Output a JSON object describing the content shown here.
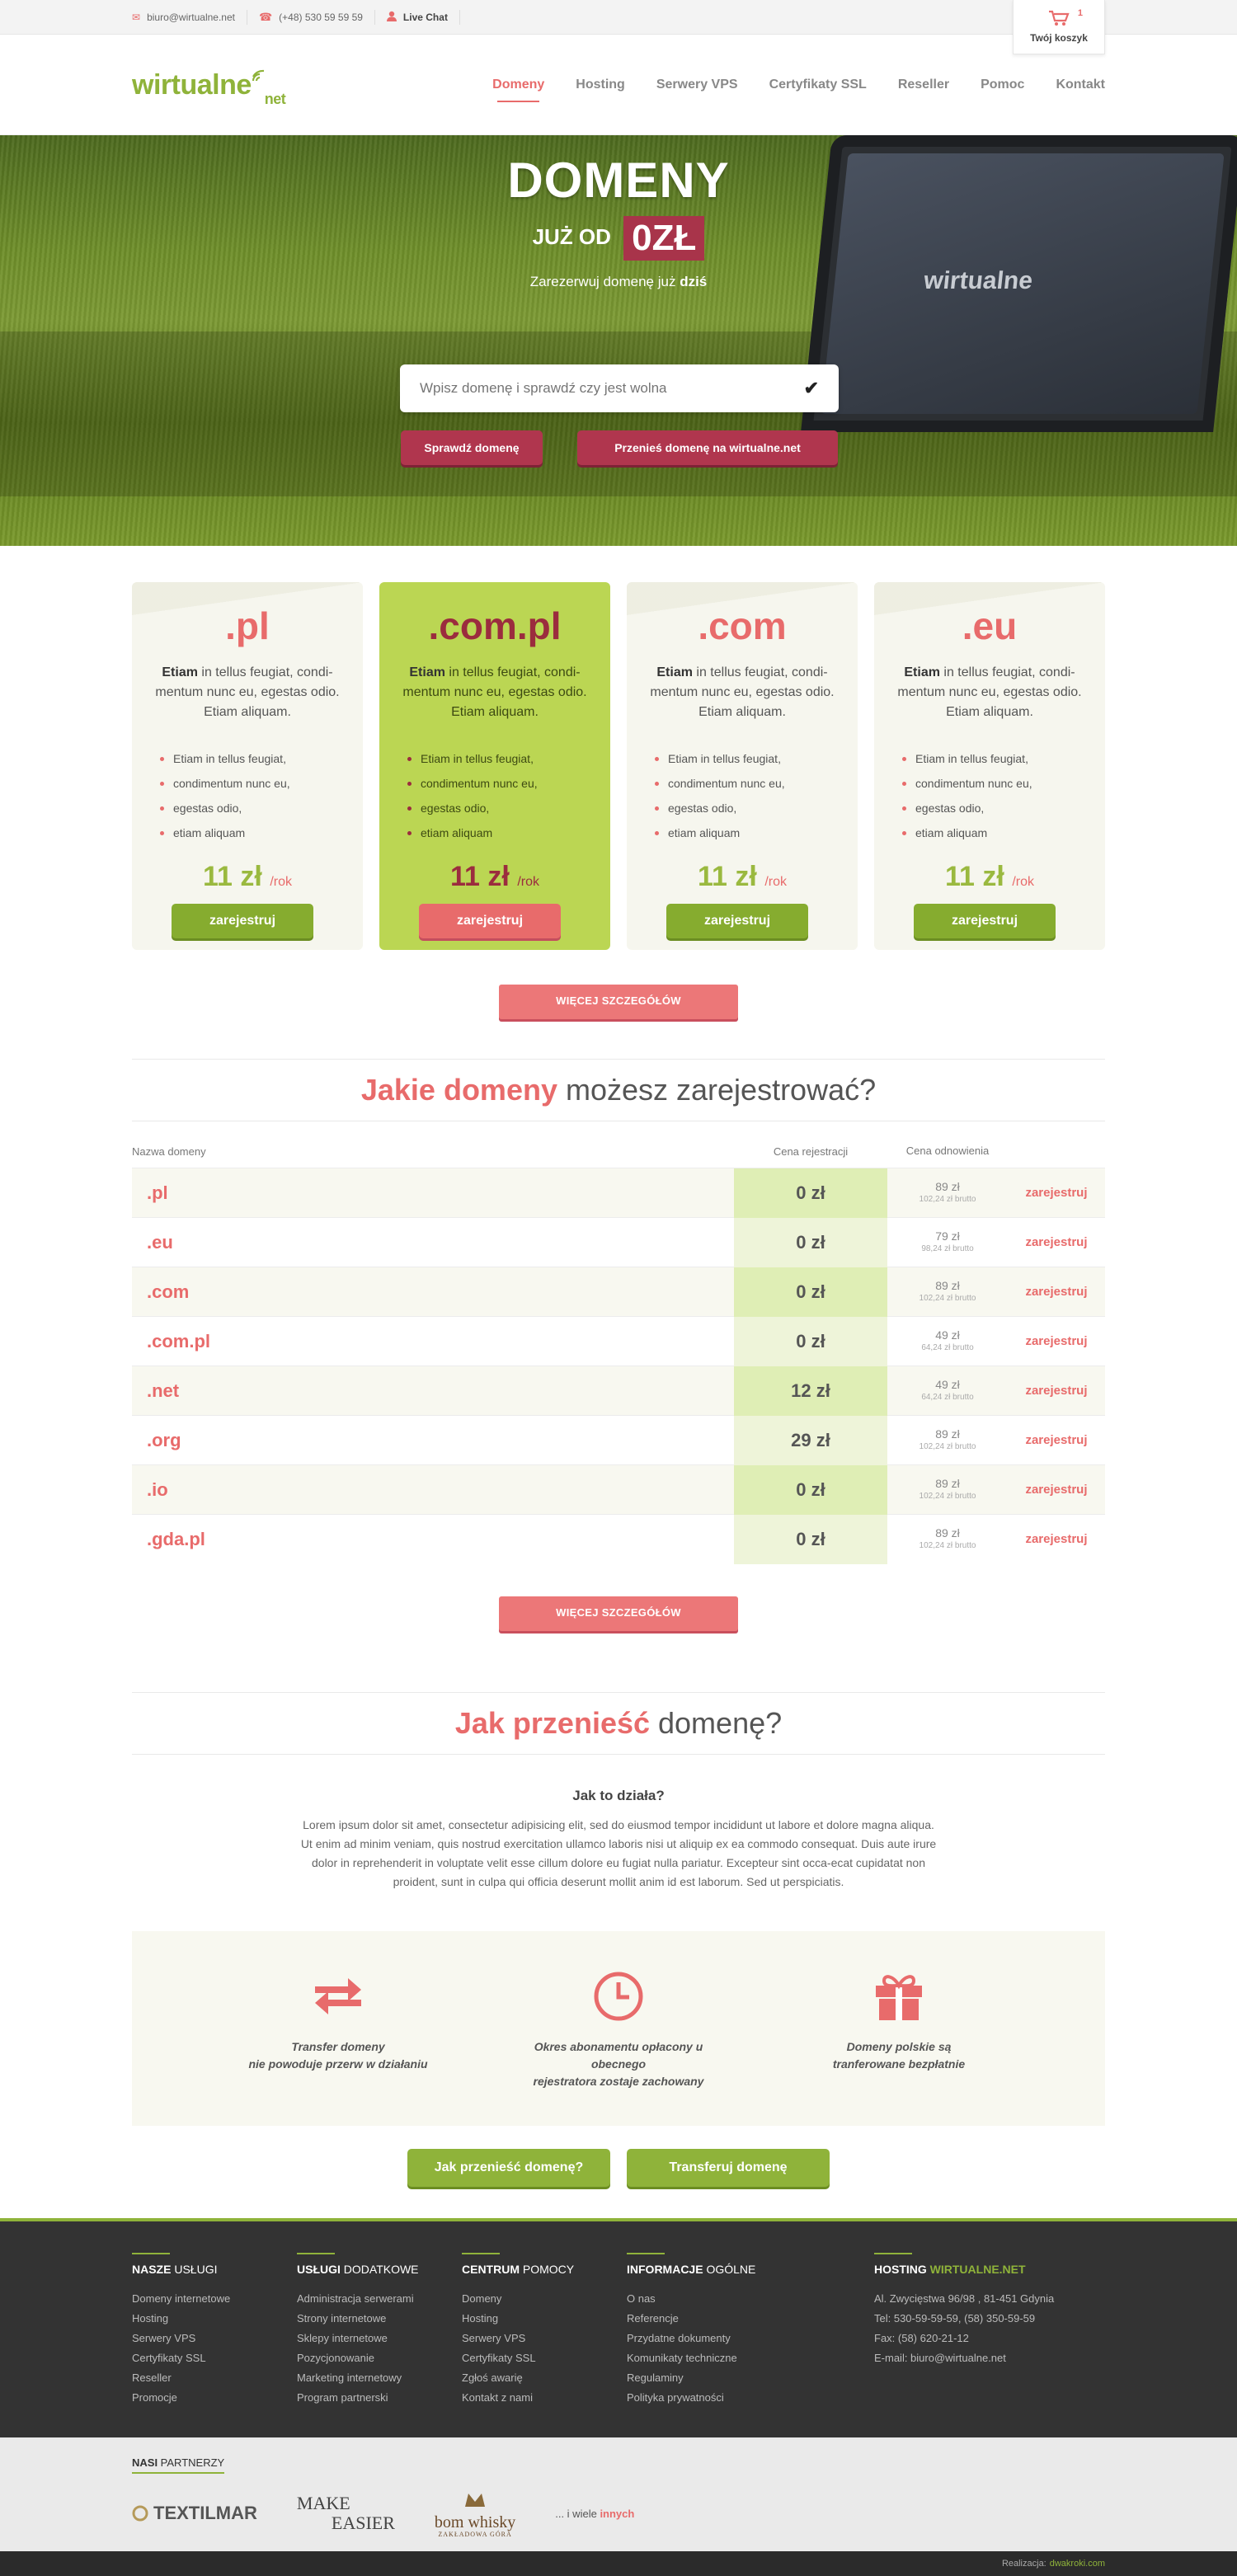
{
  "topbar": {
    "email": "biuro@wirtualne.net",
    "phone": "(+48) 530 59 59 59",
    "live_chat": "Live Chat",
    "cart_label": "Twój koszyk",
    "cart_count": "1"
  },
  "header": {
    "logo_main": "wirtualne",
    "logo_sub": "net",
    "nav": [
      "Domeny",
      "Hosting",
      "Serwery VPS",
      "Certyfikaty SSL",
      "Reseller",
      "Pomoc",
      "Kontakt"
    ]
  },
  "hero": {
    "title": "DOMENY",
    "sub_prefix": "JUŻ OD",
    "price": "0ZŁ",
    "tagline": "Zarezerwuj domenę już",
    "tagline_bold": "dziś",
    "search_placeholder": "Wpisz domenę i sprawdź czy jest wolna",
    "check_button": "Sprawdź domenę",
    "transfer_button": "Przenieś domenę na wirtualne.net",
    "laptop_brand": "wirtualne"
  },
  "cards": [
    {
      "tld": ".pl",
      "desc_bold": "Etiam",
      "desc": " in tellus feugiat, condi-mentum nunc eu, egestas odio. Etiam aliquam.",
      "items": [
        "Etiam in tellus feugiat,",
        "condimentum nunc eu,",
        "egestas odio,",
        "etiam aliquam"
      ],
      "price": "11 zł",
      "period": "/rok",
      "button": "zarejestruj"
    },
    {
      "tld": ".com.pl",
      "desc_bold": "Etiam",
      "desc": " in tellus feugiat, condi-mentum nunc eu, egestas odio. Etiam aliquam.",
      "items": [
        "Etiam in tellus feugiat,",
        "condimentum nunc eu,",
        "egestas odio,",
        "etiam aliquam"
      ],
      "price": "11 zł",
      "period": "/rok",
      "button": "zarejestruj"
    },
    {
      "tld": ".com",
      "desc_bold": "Etiam",
      "desc": " in tellus feugiat, condi-mentum nunc eu, egestas odio. Etiam aliquam.",
      "items": [
        "Etiam in tellus feugiat,",
        "condimentum nunc eu,",
        "egestas odio,",
        "etiam aliquam"
      ],
      "price": "11 zł",
      "period": "/rok",
      "button": "zarejestruj"
    },
    {
      "tld": ".eu",
      "desc_bold": "Etiam",
      "desc": " in tellus feugiat, condi-mentum nunc eu, egestas odio. Etiam aliquam.",
      "items": [
        "Etiam in tellus feugiat,",
        "condimentum nunc eu,",
        "egestas odio,",
        "etiam aliquam"
      ],
      "price": "11 zł",
      "period": "/rok",
      "button": "zarejestruj"
    }
  ],
  "more_button": "WIĘCEJ SZCZEGÓŁÓW",
  "domains_section": {
    "title_bold": "Jakie domeny",
    "title_rest": " możesz zarejestrować?",
    "headers": [
      "Nazwa domeny",
      "Cena rejestracji",
      "Cena odnowienia"
    ],
    "rows": [
      {
        "name": ".pl",
        "reg": "0 zł",
        "renew": "89 zł",
        "renew_gross": "102,24 zł brutto",
        "action": "zarejestruj"
      },
      {
        "name": ".eu",
        "reg": "0 zł",
        "renew": "79 zł",
        "renew_gross": "98,24 zł brutto",
        "action": "zarejestruj"
      },
      {
        "name": ".com",
        "reg": "0 zł",
        "renew": "89 zł",
        "renew_gross": "102,24 zł brutto",
        "action": "zarejestruj"
      },
      {
        "name": ".com.pl",
        "reg": "0 zł",
        "renew": "49 zł",
        "renew_gross": "64,24 zł brutto",
        "action": "zarejestruj"
      },
      {
        "name": ".net",
        "reg": "12 zł",
        "renew": "49 zł",
        "renew_gross": "64,24 zł brutto",
        "action": "zarejestruj"
      },
      {
        "name": ".org",
        "reg": "29 zł",
        "renew": "89 zł",
        "renew_gross": "102,24 zł brutto",
        "action": "zarejestruj"
      },
      {
        "name": ".io",
        "reg": "0 zł",
        "renew": "89 zł",
        "renew_gross": "102,24 zł brutto",
        "action": "zarejestruj"
      },
      {
        "name": ".gda.pl",
        "reg": "0 zł",
        "renew": "89 zł",
        "renew_gross": "102,24 zł brutto",
        "action": "zarejestruj"
      }
    ],
    "more_button": "WIĘCEJ SZCZEGÓŁÓW"
  },
  "transfer_section": {
    "title_bold": "Jak przenieść",
    "title_rest": " domenę?",
    "how_heading": "Jak to działa?",
    "how_text": "Lorem ipsum dolor sit amet, consectetur adipisicing elit, sed do eiusmod tempor incididunt ut labore et dolore magna aliqua. Ut enim ad minim veniam, quis nostrud exercitation ullamco laboris nisi ut aliquip ex ea commodo consequat. Duis aute irure dolor in reprehenderit in voluptate velit esse cillum dolore eu fugiat nulla pariatur. Excepteur sint occa-ecat cupidatat non proident, sunt in culpa qui officia deserunt mollit anim id est laborum. Sed ut perspiciatis.",
    "features": [
      {
        "icon": "transfer-arrows-icon",
        "line1": "Transfer domeny",
        "line2": "nie powoduje przerw w działaniu"
      },
      {
        "icon": "clock-icon",
        "line1": "Okres abonamentu opłacony u obecnego",
        "line2": "rejestratora zostaje zachowany"
      },
      {
        "icon": "gift-icon",
        "line1": "Domeny polskie są",
        "line2": "tranferowane bezpłatnie"
      }
    ],
    "btn_how": "Jak przenieść domenę?",
    "btn_transfer": "Transferuj domenę"
  },
  "footer": {
    "columns": [
      {
        "title_bold": "NASZE",
        "title_rest": " USŁUGI",
        "links": [
          "Domeny internetowe",
          "Hosting",
          "Serwery VPS",
          "Certyfikaty SSL",
          "Reseller",
          "Promocje"
        ]
      },
      {
        "title_bold": "USŁUGI",
        "title_rest": " DODATKOWE",
        "links": [
          "Administracja serwerami",
          "Strony internetowe",
          "Sklepy internetowe",
          "Pozycjonowanie",
          "Marketing internetowy",
          "Program partnerski"
        ]
      },
      {
        "title_bold": "CENTRUM",
        "title_rest": " POMOCY",
        "links": [
          "Domeny",
          "Hosting",
          "Serwery VPS",
          "Certyfikaty SSL",
          "Zgłoś awarię",
          "Kontakt z nami"
        ]
      },
      {
        "title_bold": "INFORMACJE",
        "title_rest": " OGÓLNE",
        "links": [
          "O nas",
          "Referencje",
          "Przydatne dokumenty",
          "Komunikaty techniczne",
          "Regulaminy",
          "Polityka prywatności"
        ]
      }
    ],
    "hosting": {
      "title_bold": "HOSTING",
      "title_green": " WIRTUALNE.NET",
      "lines": [
        "Al. Zwycięstwa 96/98 , 81-451 Gdynia",
        "Tel: 530-59-59-59, (58) 350-59-59",
        "Fax: (58) 620-21-12",
        "E-mail: biuro@wirtualne.net"
      ]
    }
  },
  "partners": {
    "title_bold": "NASI",
    "title_rest": " PARTNERZY",
    "logos": [
      "TEXTILMAR",
      "MAKE",
      "EASIER",
      "bom whisky",
      "ZAKŁADOWA GÓRA"
    ],
    "more_prefix": "... i wiele",
    "more_link": "innych"
  },
  "bottom": {
    "label": "Realizacja:",
    "author": "dwakroki.com"
  }
}
